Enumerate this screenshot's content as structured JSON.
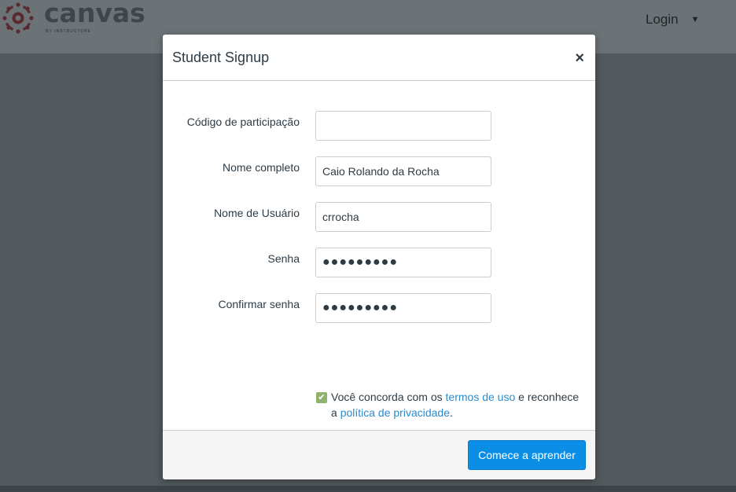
{
  "app": {
    "logo_text": "canvas",
    "logo_subtext": "BY INSTRUCTURE",
    "login_label": "Login",
    "login_caret": "▼"
  },
  "modal": {
    "title": "Student Signup",
    "close_label": "×",
    "fields": [
      {
        "label": "Código de participação",
        "value": "",
        "type": "text"
      },
      {
        "label": "Nome completo",
        "value": "Caio Rolando da Rocha",
        "type": "text"
      },
      {
        "label": "Nome de Usuário",
        "value": "crrocha",
        "type": "text"
      },
      {
        "label": "Senha",
        "value": "●●●●●●●●●",
        "type": "password"
      },
      {
        "label": "Confirmar senha",
        "value": "●●●●●●●●●",
        "type": "password"
      }
    ],
    "agree": {
      "checked": true,
      "check_glyph": "✔",
      "text_before": "Você concorda com os ",
      "terms_link": "termos de uso",
      "text_middle": " e reconhece a ",
      "privacy_link": "política de privacidade",
      "text_after": "."
    },
    "submit_label": "Comece a aprender"
  },
  "colors": {
    "accent": "#0b8ee6",
    "link": "#2b8acb",
    "checkbox": "#8fb36e",
    "logo_red": "#9b2c36"
  }
}
